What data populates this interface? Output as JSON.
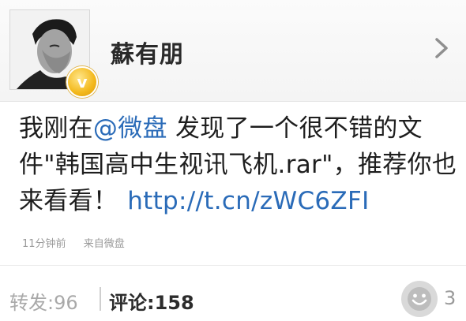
{
  "profile": {
    "username": "蘇有朋",
    "verified_mark": "v"
  },
  "post": {
    "text_before_mention": "我刚在",
    "mention": "@微盘",
    "text_after_mention": " 发现了一个很不错的文件\"韩国高中生视讯飞机.rar\"，推荐你也来看看！",
    "link": "http://t.cn/zWC6ZFI",
    "time": "11分钟前",
    "source": "来自微盘"
  },
  "footer": {
    "repost": "转发:96",
    "comment": "评论:158",
    "likes": "3"
  },
  "colors": {
    "link": "#2a6bb8",
    "verified_badge": "#f3b81b"
  }
}
